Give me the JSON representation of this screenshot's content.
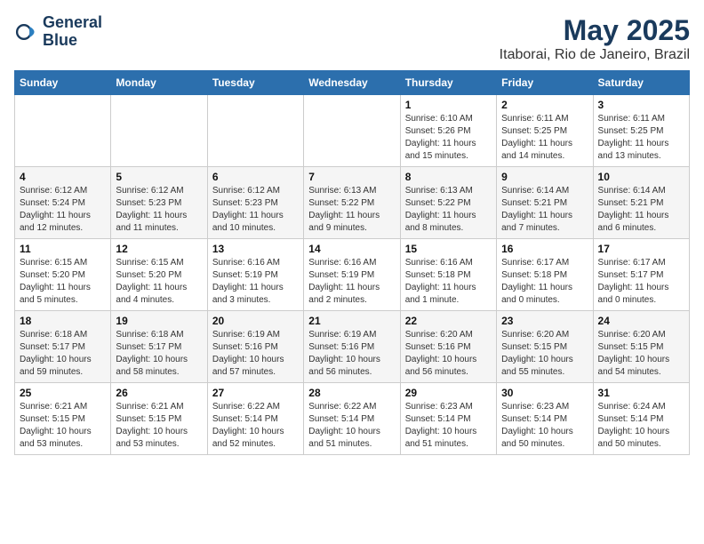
{
  "logo": {
    "line1": "General",
    "line2": "Blue"
  },
  "title": "May 2025",
  "subtitle": "Itaborai, Rio de Janeiro, Brazil",
  "weekdays": [
    "Sunday",
    "Monday",
    "Tuesday",
    "Wednesday",
    "Thursday",
    "Friday",
    "Saturday"
  ],
  "weeks": [
    [
      {
        "day": "",
        "info": ""
      },
      {
        "day": "",
        "info": ""
      },
      {
        "day": "",
        "info": ""
      },
      {
        "day": "",
        "info": ""
      },
      {
        "day": "1",
        "info": "Sunrise: 6:10 AM\nSunset: 5:26 PM\nDaylight: 11 hours\nand 15 minutes."
      },
      {
        "day": "2",
        "info": "Sunrise: 6:11 AM\nSunset: 5:25 PM\nDaylight: 11 hours\nand 14 minutes."
      },
      {
        "day": "3",
        "info": "Sunrise: 6:11 AM\nSunset: 5:25 PM\nDaylight: 11 hours\nand 13 minutes."
      }
    ],
    [
      {
        "day": "4",
        "info": "Sunrise: 6:12 AM\nSunset: 5:24 PM\nDaylight: 11 hours\nand 12 minutes."
      },
      {
        "day": "5",
        "info": "Sunrise: 6:12 AM\nSunset: 5:23 PM\nDaylight: 11 hours\nand 11 minutes."
      },
      {
        "day": "6",
        "info": "Sunrise: 6:12 AM\nSunset: 5:23 PM\nDaylight: 11 hours\nand 10 minutes."
      },
      {
        "day": "7",
        "info": "Sunrise: 6:13 AM\nSunset: 5:22 PM\nDaylight: 11 hours\nand 9 minutes."
      },
      {
        "day": "8",
        "info": "Sunrise: 6:13 AM\nSunset: 5:22 PM\nDaylight: 11 hours\nand 8 minutes."
      },
      {
        "day": "9",
        "info": "Sunrise: 6:14 AM\nSunset: 5:21 PM\nDaylight: 11 hours\nand 7 minutes."
      },
      {
        "day": "10",
        "info": "Sunrise: 6:14 AM\nSunset: 5:21 PM\nDaylight: 11 hours\nand 6 minutes."
      }
    ],
    [
      {
        "day": "11",
        "info": "Sunrise: 6:15 AM\nSunset: 5:20 PM\nDaylight: 11 hours\nand 5 minutes."
      },
      {
        "day": "12",
        "info": "Sunrise: 6:15 AM\nSunset: 5:20 PM\nDaylight: 11 hours\nand 4 minutes."
      },
      {
        "day": "13",
        "info": "Sunrise: 6:16 AM\nSunset: 5:19 PM\nDaylight: 11 hours\nand 3 minutes."
      },
      {
        "day": "14",
        "info": "Sunrise: 6:16 AM\nSunset: 5:19 PM\nDaylight: 11 hours\nand 2 minutes."
      },
      {
        "day": "15",
        "info": "Sunrise: 6:16 AM\nSunset: 5:18 PM\nDaylight: 11 hours\nand 1 minute."
      },
      {
        "day": "16",
        "info": "Sunrise: 6:17 AM\nSunset: 5:18 PM\nDaylight: 11 hours\nand 0 minutes."
      },
      {
        "day": "17",
        "info": "Sunrise: 6:17 AM\nSunset: 5:17 PM\nDaylight: 11 hours\nand 0 minutes."
      }
    ],
    [
      {
        "day": "18",
        "info": "Sunrise: 6:18 AM\nSunset: 5:17 PM\nDaylight: 10 hours\nand 59 minutes."
      },
      {
        "day": "19",
        "info": "Sunrise: 6:18 AM\nSunset: 5:17 PM\nDaylight: 10 hours\nand 58 minutes."
      },
      {
        "day": "20",
        "info": "Sunrise: 6:19 AM\nSunset: 5:16 PM\nDaylight: 10 hours\nand 57 minutes."
      },
      {
        "day": "21",
        "info": "Sunrise: 6:19 AM\nSunset: 5:16 PM\nDaylight: 10 hours\nand 56 minutes."
      },
      {
        "day": "22",
        "info": "Sunrise: 6:20 AM\nSunset: 5:16 PM\nDaylight: 10 hours\nand 56 minutes."
      },
      {
        "day": "23",
        "info": "Sunrise: 6:20 AM\nSunset: 5:15 PM\nDaylight: 10 hours\nand 55 minutes."
      },
      {
        "day": "24",
        "info": "Sunrise: 6:20 AM\nSunset: 5:15 PM\nDaylight: 10 hours\nand 54 minutes."
      }
    ],
    [
      {
        "day": "25",
        "info": "Sunrise: 6:21 AM\nSunset: 5:15 PM\nDaylight: 10 hours\nand 53 minutes."
      },
      {
        "day": "26",
        "info": "Sunrise: 6:21 AM\nSunset: 5:15 PM\nDaylight: 10 hours\nand 53 minutes."
      },
      {
        "day": "27",
        "info": "Sunrise: 6:22 AM\nSunset: 5:14 PM\nDaylight: 10 hours\nand 52 minutes."
      },
      {
        "day": "28",
        "info": "Sunrise: 6:22 AM\nSunset: 5:14 PM\nDaylight: 10 hours\nand 51 minutes."
      },
      {
        "day": "29",
        "info": "Sunrise: 6:23 AM\nSunset: 5:14 PM\nDaylight: 10 hours\nand 51 minutes."
      },
      {
        "day": "30",
        "info": "Sunrise: 6:23 AM\nSunset: 5:14 PM\nDaylight: 10 hours\nand 50 minutes."
      },
      {
        "day": "31",
        "info": "Sunrise: 6:24 AM\nSunset: 5:14 PM\nDaylight: 10 hours\nand 50 minutes."
      }
    ]
  ]
}
